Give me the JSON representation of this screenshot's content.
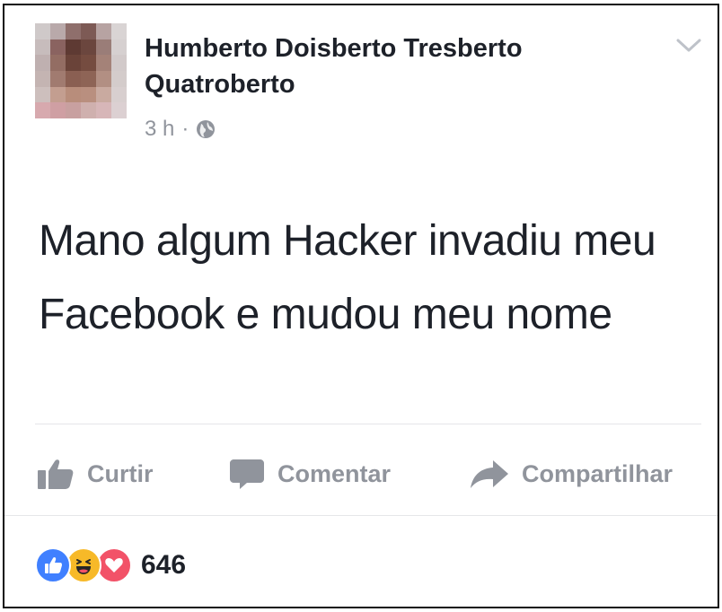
{
  "post": {
    "author_name": "Humberto Doisberto Tresberto Quatroberto",
    "timestamp": "3 h",
    "separator": "·",
    "audience_icon": "globe-icon",
    "menu_icon": "chevron-down-icon",
    "text": "Mano algum Hacker invadiu meu Facebook e mudou meu nome"
  },
  "actions": {
    "like_label": "Curtir",
    "comment_label": "Comentar",
    "share_label": "Compartilhar"
  },
  "reactions": {
    "types": [
      "like-reaction-icon",
      "haha-reaction-icon",
      "love-reaction-icon"
    ],
    "count": "646"
  },
  "colors": {
    "text_primary": "#1d2129",
    "text_secondary": "#90949c",
    "like_blue": "#4080ff",
    "haha_yellow": "#f7b928",
    "love_red": "#f25268",
    "divider": "#e5e6e9"
  }
}
